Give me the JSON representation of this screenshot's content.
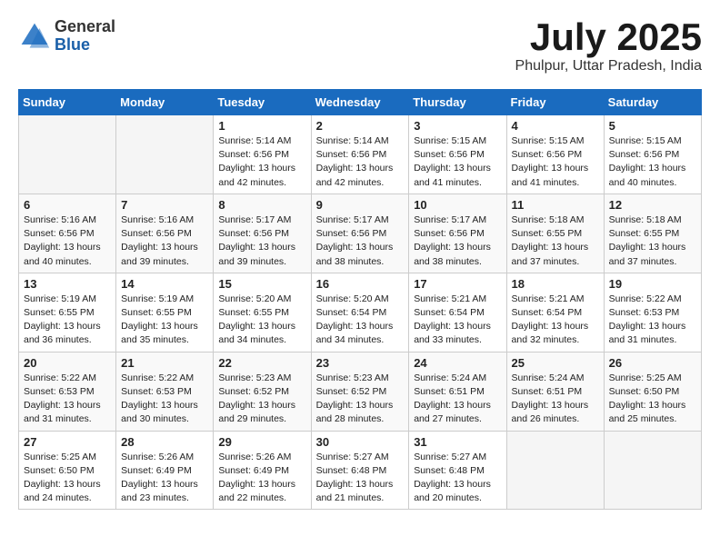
{
  "logo": {
    "general": "General",
    "blue": "Blue"
  },
  "title": "July 2025",
  "location": "Phulpur, Uttar Pradesh, India",
  "headers": [
    "Sunday",
    "Monday",
    "Tuesday",
    "Wednesday",
    "Thursday",
    "Friday",
    "Saturday"
  ],
  "weeks": [
    [
      {
        "day": "",
        "info": ""
      },
      {
        "day": "",
        "info": ""
      },
      {
        "day": "1",
        "info": "Sunrise: 5:14 AM\nSunset: 6:56 PM\nDaylight: 13 hours and 42 minutes."
      },
      {
        "day": "2",
        "info": "Sunrise: 5:14 AM\nSunset: 6:56 PM\nDaylight: 13 hours and 42 minutes."
      },
      {
        "day": "3",
        "info": "Sunrise: 5:15 AM\nSunset: 6:56 PM\nDaylight: 13 hours and 41 minutes."
      },
      {
        "day": "4",
        "info": "Sunrise: 5:15 AM\nSunset: 6:56 PM\nDaylight: 13 hours and 41 minutes."
      },
      {
        "day": "5",
        "info": "Sunrise: 5:15 AM\nSunset: 6:56 PM\nDaylight: 13 hours and 40 minutes."
      }
    ],
    [
      {
        "day": "6",
        "info": "Sunrise: 5:16 AM\nSunset: 6:56 PM\nDaylight: 13 hours and 40 minutes."
      },
      {
        "day": "7",
        "info": "Sunrise: 5:16 AM\nSunset: 6:56 PM\nDaylight: 13 hours and 39 minutes."
      },
      {
        "day": "8",
        "info": "Sunrise: 5:17 AM\nSunset: 6:56 PM\nDaylight: 13 hours and 39 minutes."
      },
      {
        "day": "9",
        "info": "Sunrise: 5:17 AM\nSunset: 6:56 PM\nDaylight: 13 hours and 38 minutes."
      },
      {
        "day": "10",
        "info": "Sunrise: 5:17 AM\nSunset: 6:56 PM\nDaylight: 13 hours and 38 minutes."
      },
      {
        "day": "11",
        "info": "Sunrise: 5:18 AM\nSunset: 6:55 PM\nDaylight: 13 hours and 37 minutes."
      },
      {
        "day": "12",
        "info": "Sunrise: 5:18 AM\nSunset: 6:55 PM\nDaylight: 13 hours and 37 minutes."
      }
    ],
    [
      {
        "day": "13",
        "info": "Sunrise: 5:19 AM\nSunset: 6:55 PM\nDaylight: 13 hours and 36 minutes."
      },
      {
        "day": "14",
        "info": "Sunrise: 5:19 AM\nSunset: 6:55 PM\nDaylight: 13 hours and 35 minutes."
      },
      {
        "day": "15",
        "info": "Sunrise: 5:20 AM\nSunset: 6:55 PM\nDaylight: 13 hours and 34 minutes."
      },
      {
        "day": "16",
        "info": "Sunrise: 5:20 AM\nSunset: 6:54 PM\nDaylight: 13 hours and 34 minutes."
      },
      {
        "day": "17",
        "info": "Sunrise: 5:21 AM\nSunset: 6:54 PM\nDaylight: 13 hours and 33 minutes."
      },
      {
        "day": "18",
        "info": "Sunrise: 5:21 AM\nSunset: 6:54 PM\nDaylight: 13 hours and 32 minutes."
      },
      {
        "day": "19",
        "info": "Sunrise: 5:22 AM\nSunset: 6:53 PM\nDaylight: 13 hours and 31 minutes."
      }
    ],
    [
      {
        "day": "20",
        "info": "Sunrise: 5:22 AM\nSunset: 6:53 PM\nDaylight: 13 hours and 31 minutes."
      },
      {
        "day": "21",
        "info": "Sunrise: 5:22 AM\nSunset: 6:53 PM\nDaylight: 13 hours and 30 minutes."
      },
      {
        "day": "22",
        "info": "Sunrise: 5:23 AM\nSunset: 6:52 PM\nDaylight: 13 hours and 29 minutes."
      },
      {
        "day": "23",
        "info": "Sunrise: 5:23 AM\nSunset: 6:52 PM\nDaylight: 13 hours and 28 minutes."
      },
      {
        "day": "24",
        "info": "Sunrise: 5:24 AM\nSunset: 6:51 PM\nDaylight: 13 hours and 27 minutes."
      },
      {
        "day": "25",
        "info": "Sunrise: 5:24 AM\nSunset: 6:51 PM\nDaylight: 13 hours and 26 minutes."
      },
      {
        "day": "26",
        "info": "Sunrise: 5:25 AM\nSunset: 6:50 PM\nDaylight: 13 hours and 25 minutes."
      }
    ],
    [
      {
        "day": "27",
        "info": "Sunrise: 5:25 AM\nSunset: 6:50 PM\nDaylight: 13 hours and 24 minutes."
      },
      {
        "day": "28",
        "info": "Sunrise: 5:26 AM\nSunset: 6:49 PM\nDaylight: 13 hours and 23 minutes."
      },
      {
        "day": "29",
        "info": "Sunrise: 5:26 AM\nSunset: 6:49 PM\nDaylight: 13 hours and 22 minutes."
      },
      {
        "day": "30",
        "info": "Sunrise: 5:27 AM\nSunset: 6:48 PM\nDaylight: 13 hours and 21 minutes."
      },
      {
        "day": "31",
        "info": "Sunrise: 5:27 AM\nSunset: 6:48 PM\nDaylight: 13 hours and 20 minutes."
      },
      {
        "day": "",
        "info": ""
      },
      {
        "day": "",
        "info": ""
      }
    ]
  ]
}
